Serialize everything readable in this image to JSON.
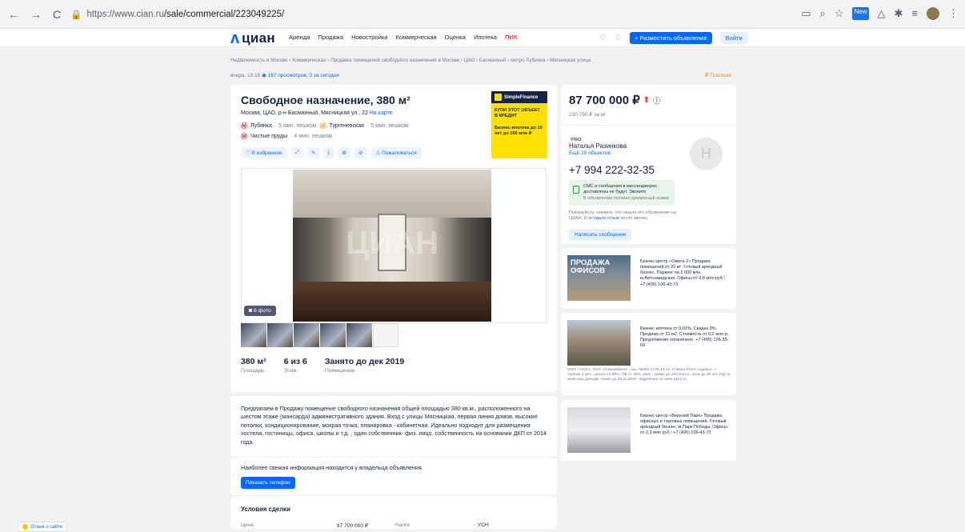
{
  "browser": {
    "back": "←",
    "forward": "→",
    "reload": "C",
    "url_host": "https://www.cian.ru",
    "url_path": "/sale/commercial/223049225/",
    "new_badge": "New"
  },
  "header": {
    "logo": "циан",
    "menu": [
      "Аренда",
      "Продажа",
      "Новостройки",
      "Коммерческая",
      "Оценка",
      "Ипотека"
    ],
    "pik": "ПИК",
    "post_button": "+ Разместить объявление",
    "login_button": "Войти"
  },
  "breadcrumbs": "Недвижимость в Москве  ›  Коммерческая  ›  Продажа помещений свободного назначения в Москве  ›  ЦАО  ›  Басманный  ›  метро Лубянка  ›  Мясницкая улица",
  "meta": {
    "date": "вчера, 13:16",
    "views": "167 просмотров, 0 за сегодня",
    "paid": "₽  Платное"
  },
  "listing": {
    "title": "Свободное назначение, 380 м²",
    "address": "Москва, ЦАО, р-н Басманный, Мясницкая ул., 22",
    "map_link": "На карте",
    "metro": [
      {
        "name": "Лубянка",
        "walk": "· 5 мин. пешком",
        "color": "#e7342d"
      },
      {
        "name": "Тургеневская",
        "walk": "· 5 мин. пешком",
        "color": "#f5a623"
      },
      {
        "name": "Чистые пруды",
        "walk": "· 4 мин. пешком",
        "color": "#e7342d"
      }
    ],
    "favorite": "В избранное",
    "complain": "Пожаловаться",
    "photo_count": "6 фото",
    "watermark": "ЦИАН",
    "facts": [
      {
        "value": "380 м²",
        "label": "Площадь"
      },
      {
        "value": "6 из 6",
        "label": "Этаж"
      },
      {
        "value": "Занято до дек 2019",
        "label": "Помещение"
      }
    ],
    "description": "Предлагаем в Продажу помещение свободного назначения общей площадью 380 кв.м., расположенного на шестом этаже (мансарда) административного здания. Вход с улицы Мясницкая, первая линия домов, высокие потолки, кондиционирование, мокрая точка, планировка - кабинетная. Идеально подходит для размещения хостела, гостиницы, офиса, школы и т.д. , один собственник- физ. лицо, собственность на основании ДКП от 2014 года.",
    "contact_info": "Наиболее свежая информация находится у владельца объявления.",
    "show_phone": "Показать телефон",
    "terms_title": "Условия сделки",
    "terms": {
      "price_label": "Цена",
      "price": "87 700 000 ₽",
      "tax_label": "Налог",
      "tax": "УСН"
    }
  },
  "ad_banner": {
    "brand": "SimpleFinance",
    "line1": "КУПИ ЭТОТ ОБЪЕКТ В КРЕДИТ",
    "line2": "Бизнес-ипотека до 10 лет до 150 млн ₽"
  },
  "sidebar": {
    "price": "87 700 000 ₽",
    "price_per_m": "230 790 ₽ за м²",
    "pro_badge": "PRO",
    "agent_name": "Наталья Разинкова",
    "agent_more": "Ещё 28 объектов",
    "avatar_letter": "Н",
    "phone": "+7 994 222-32-35",
    "sms_title": "СМС и сообщения в мессенджерах доставлены не будут. Звоните",
    "sms_note": "В объявлении показан временный номер",
    "hint_text": "Пожалуйста, скажите, что нашли это объявление на ЦИАН. И",
    "hint_link": "оставьте отзыв",
    "hint_tail": "после звонка",
    "message_button": "Написать сообщение"
  },
  "promos": [
    {
      "image_text": "ПРОДАЖА ОФИСОВ",
      "text": "Бизнес-центр «Омега-2» Продажа помещений от 20 м². Готовый арендный бизнес. Паркинг на 2 000 м/м. м.Автозаводская. Офисы от 2,8 млн руб.! +7 (495) 106-43-73"
    },
    {
      "text": "Бизнес ипотека от 0,01%. Скидка 3%. Продажа от 21 м2. Стоимость от 6,2 млн р. Предложение ограничено. +7 (495) 126-35-69",
      "legal": "ООО «А101», ПАО «Совкомбанк», лиц. №963 от 05.12.14. Ставка 0,01% годовых — первые 4 мес., далее 10,99%. ПВ от 30%, макс. сумма до 200 млн р., срок до 30 лет. ПД на www.наш.дом.рф. Акция до 30.11.2020, подробнее на www.a101.ru"
    },
    {
      "text": "Бизнес-центр «Верхний Парк» Продажа офисных и торговых помещений. Готовый арендный бизнес. м.Парк Победы. Офисы от 2,3 млн руб.! +7 (495) 106-43-73"
    }
  ],
  "feedback": "Отзыв о сайте"
}
